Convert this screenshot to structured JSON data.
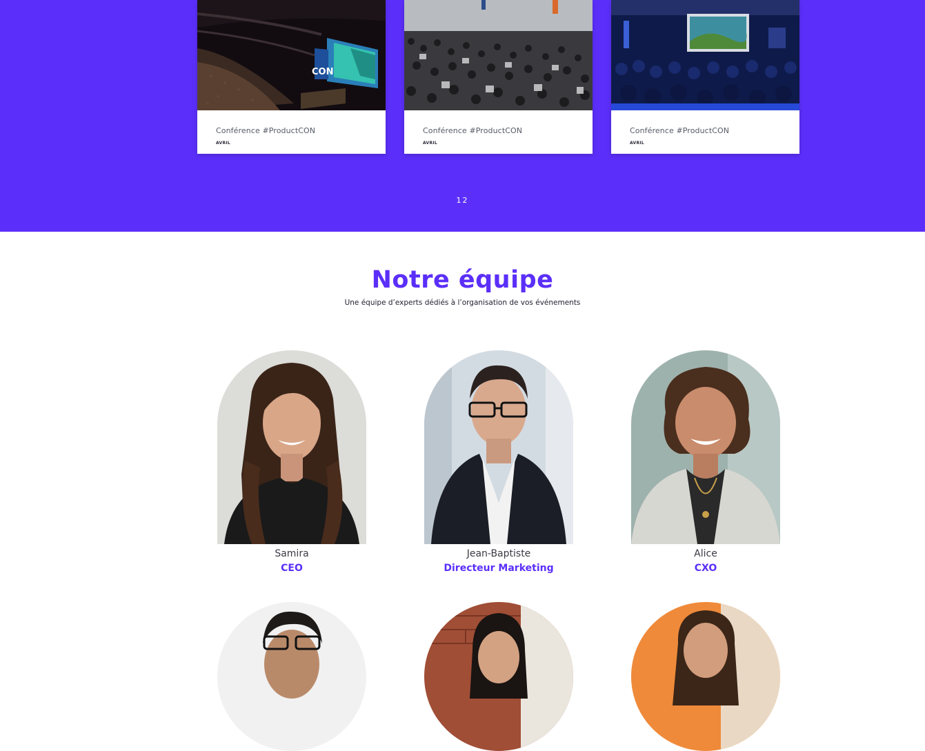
{
  "events": [
    {
      "title": "Conférence #ProductCON",
      "month": "AVRIL",
      "photo": "conference-stage-photo"
    },
    {
      "title": "Conférence #ProductCON",
      "month": "AVRIL",
      "photo": "conference-crowd-photo"
    },
    {
      "title": "Conférence #ProductCON",
      "month": "AVRIL",
      "photo": "conference-screen-photo"
    }
  ],
  "pagination": {
    "pages": [
      "1",
      "2"
    ]
  },
  "team": {
    "title": "Notre équipe",
    "subtitle": "Une équipe d’experts dédiés à l’organisation de vos événements",
    "members": [
      {
        "name": "Samira",
        "role": "CEO"
      },
      {
        "name": "Jean-Baptiste",
        "role": "Directeur Marketing"
      },
      {
        "name": "Alice",
        "role": "CXO"
      },
      {
        "name": "",
        "role": ""
      },
      {
        "name": "",
        "role": ""
      },
      {
        "name": "",
        "role": ""
      }
    ]
  },
  "colors": {
    "brand": "#5b2ff9",
    "card": "#ffffff",
    "text": "#3a3a44"
  }
}
